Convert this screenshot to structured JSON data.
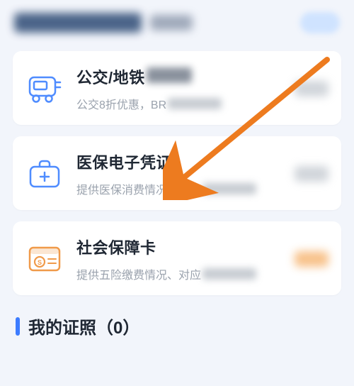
{
  "cards": [
    {
      "id": "bus",
      "title": "公交/地铁",
      "title_has_blur_suffix": true,
      "desc": "公交8折优惠，BR",
      "action_color": "grey",
      "icon": "bus"
    },
    {
      "id": "medical",
      "title": "医保电子凭证",
      "title_has_blur_suffix": false,
      "desc": "提供医保消费情况、对应",
      "action_color": "grey",
      "icon": "medical"
    },
    {
      "id": "social",
      "title": "社会保障卡",
      "title_has_blur_suffix": false,
      "desc": "提供五险缴费情况、对应",
      "action_color": "orange",
      "icon": "social"
    }
  ],
  "section": {
    "title": "我的证照（0）"
  },
  "colors": {
    "accent": "#3d7cff",
    "arrow": "#ed7b1f"
  }
}
